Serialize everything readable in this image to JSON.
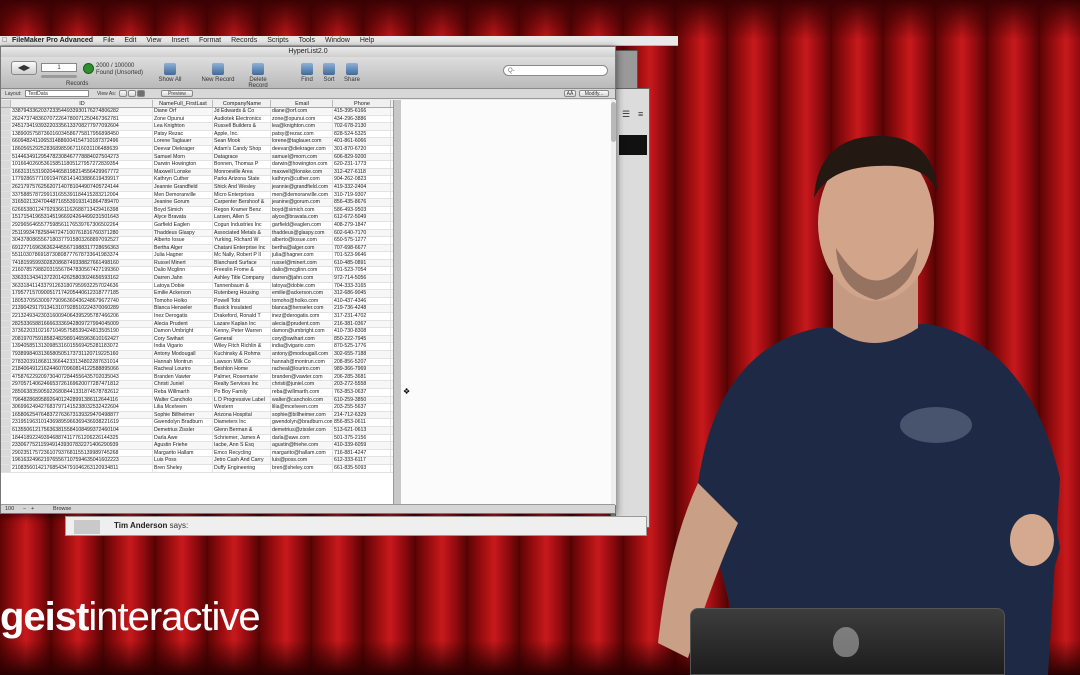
{
  "menubar": {
    "app_name": "FileMaker Pro Advanced",
    "items": [
      "File",
      "Edit",
      "View",
      "Insert",
      "Format",
      "Records",
      "Scripts",
      "Tools",
      "Window",
      "Help"
    ]
  },
  "window": {
    "title": "HyperList2.0",
    "toolbar": {
      "record_input": "1",
      "records_label": "Records",
      "found_count": "2000 / 100000",
      "found_status": "Found (Unsorted)",
      "show_all": "Show All",
      "new_record": "New Record",
      "delete_record": "Delete Record",
      "find": "Find",
      "sort": "Sort",
      "share": "Share",
      "search_placeholder": "Q-"
    },
    "layout_bar": {
      "layout_label": "Layout:",
      "layout_value": "TestData",
      "view_as_label": "View As:",
      "preview_button": "Preview",
      "aa_button": "AÂ",
      "modify_button": "Modify..."
    },
    "table": {
      "columns": [
        "ID",
        "NameFull_FirstLast",
        "CompanyName",
        "Email",
        "Phone"
      ],
      "rows": [
        [
          "3387943362037233544933930176274806282",
          "Diane Orf",
          "Jd Edwards & Co",
          "diane@orf.com",
          "415-395-6166"
        ],
        [
          "2624737483607072264780071250467362781",
          "Zone Opunui",
          "Audiotek Electronics",
          "zone@opunui.com",
          "434-296-3886"
        ],
        [
          "2451734193932203356133708277977092604",
          "Lea Knighton",
          "Russell Builders &",
          "lea@knighton.com",
          "702-678-2130"
        ],
        [
          "1389005758736016034586775817956898450",
          "Patsy Rezac",
          "Apple, Inc.",
          "patsy@rezac.com",
          "828-524-5325"
        ],
        [
          "6609482411065314886004154710187372496",
          "Lorene Taglauer",
          "Sean Mook",
          "lorene@taglauer.com",
          "401-861-6066"
        ],
        [
          "1860565292528368985967116031106488639",
          "Deevar Diekrager",
          "Adam's Candy Shop",
          "deevar@diekrager.com",
          "301-870-6720"
        ],
        [
          "5144634912954782308467778884027504273",
          "Samuel Morn",
          "Datagrace",
          "samuel@morn.com",
          "606-829-9200"
        ],
        [
          "1016640260536158511805127957272839354",
          "Darwin Howington",
          "Bonnen, Thomas P",
          "darwin@howington.com",
          "620-231-1773"
        ],
        [
          "1663131531902044658198214556429967772",
          "Maxwell Lonske",
          "Monroeville Area",
          "maxwell@lonske.com",
          "312-427-6118"
        ],
        [
          "1779286577109194768141403886619439917",
          "Kathryn Cuther",
          "Parks Arizona State",
          "kathryn@cuther.com",
          "904-262-0823"
        ],
        [
          "2621797576256207140781044907405724144",
          "Jeannie Grandfield",
          "Shick And Wesley",
          "jeannie@grandfield.com",
          "419-332-2404"
        ],
        [
          "3375885787299131655391184415283212004",
          "Men Demoranville",
          "Micro Enterprises",
          "men@demoranville.com",
          "310-719-9307"
        ],
        [
          "3165021324704487165539193141864789470",
          "Jeanine Gorum",
          "Carpenter Bershoof &",
          "jeanine@gorum.com",
          "856-435-8676"
        ],
        [
          "6266538012479293661162688713429416398",
          "Boyd Simich",
          "Regon Kramer Benz",
          "boyd@simich.com",
          "586-493-9503"
        ],
        [
          "1517154196531451966924264499231501643",
          "Alyce Bravata",
          "Larsen, Allen S",
          "alyce@bravata.com",
          "612-672-5049"
        ],
        [
          "2929656465577598561176539767306502264",
          "Garfield Eaglen",
          "Cogun Industries Inc",
          "garfield@eaglen.com",
          "408-279-1847"
        ],
        [
          "2511993478258447247100761816760371280",
          "Thaddeus Glaspy",
          "Associated Metals &",
          "thaddeus@glaspy.com",
          "602-640-7170"
        ],
        [
          "3043780865567180377915803268897092527",
          "Alberto Iosue",
          "Yurking, Richard W",
          "alberto@iosue.com",
          "650-575-1277"
        ],
        [
          "6912771696363624455671988317728656363",
          "Bertha Alger",
          "Chatani Enterprise Inc",
          "bertha@alger.com",
          "707-698-6677"
        ],
        [
          "5511030786918730808777678733641983374",
          "Julia Hagner",
          "Mc Nally, Robert P II",
          "julia@hagner.com",
          "701-523-9646"
        ],
        [
          "7418159599302820868749338827661498160",
          "Russel Minert",
          "Blanchard Surface",
          "russel@minert.com",
          "610-485-0891"
        ],
        [
          "2160785798820315567847830567427199360",
          "Dalio Mcglinn",
          "Freeslin Frome &",
          "dalio@mcglinn.com",
          "701-523-7054"
        ],
        [
          "3363313434137220142625803024656593162",
          "Darren Jahn",
          "Ashley Title Company",
          "darren@jahn.com",
          "972-714-5056"
        ],
        [
          "3633184114337912631807959932257024636",
          "Latoya Dobie",
          "Tannenbaum &",
          "latoya@dobie.com",
          "704-333-3165"
        ],
        [
          "1795771570900517174205440612318777185",
          "Emilie Ackerson",
          "Rutenberg Housing",
          "emilie@ackerson.com",
          "312-686-9045"
        ],
        [
          "1805370563009779096360436248679672740",
          "Tomoho Holko",
          "Powell Tobi",
          "tomoho@holko.com",
          "410-437-4346"
        ],
        [
          "2139042917913413107928510224370060289",
          "Blanca Henseler",
          "Busick Insulated",
          "blanca@henseler.com",
          "219-736-4248"
        ],
        [
          "2213249342303160094064395295787466206",
          "Inez Derogatis",
          "Drakeford, Ronald T",
          "inez@derogatis.com",
          "317-231-4702"
        ],
        [
          "2825336588166663336942809727994045009",
          "Alecia Prudent",
          "Lazare Kaplan Inc",
          "alecia@prudent.com",
          "216-381-0367"
        ],
        [
          "3736220310216710495758539424813505190",
          "Damon Umbright",
          "Kenny, Peter Warren",
          "damon@umbright.com",
          "410-730-8308"
        ],
        [
          "2081970759185824829891465963610162427",
          "Cory Swihart",
          "General",
          "cory@swihart.com",
          "850-222-7945"
        ],
        [
          "1394058513130985316015569425281183072",
          "India Vigario",
          "Wiley Fitch Richlin &",
          "india@vigario.com",
          "870-525-1776"
        ],
        [
          "7938998403136580505173731120719225160",
          "Antony Modougall",
          "Kuchinsky & Rohms",
          "antony@modougall.com",
          "302-655-7188"
        ],
        [
          "2783203918681136644233134802287631014",
          "Hannah Montrun",
          "Lawson Milk Co",
          "hannah@montrun.com",
          "208-856-5207"
        ],
        [
          "2184064912162446070960814122588895066",
          "Racheal Louriro",
          "Beshlon Home",
          "racheal@louriro.com",
          "989-366-7969"
        ],
        [
          "4758762292097304072844556435702035043",
          "Branden Vawter",
          "Palmer, Rosemarie",
          "branden@vawter.com",
          "206-285-3681"
        ],
        [
          "2970571406246653726169620077287471812",
          "Christi Juniel",
          "Realty Services Inc",
          "christi@juniel.com",
          "203-272-5558"
        ],
        [
          "2850638359059226808441331874578782612",
          "Reba Willmarth",
          "Po Boy Family",
          "reba@willmarth.com",
          "763-853-0637"
        ],
        [
          "7964828689589264012428991386112644116",
          "Walter Cancholo",
          "L D Progressive Label",
          "walter@cancholo.com",
          "610-259-3850"
        ],
        [
          "3069962494276837971415238032532422604",
          "Lilia Mcelveen",
          "Western",
          "lilia@mcelveen.com",
          "203-255-5637"
        ],
        [
          "1658062547648372763673139329470498877",
          "Sophie Billheimer",
          "Arizona Hospital",
          "sophie@billheimer.com",
          "214-712-6329"
        ],
        [
          "2319519631014369895966369436938221619",
          "Gwendolyn Bradburn",
          "Diameters Inc",
          "gwendolyn@bradburn.com",
          "856-853-0611"
        ],
        [
          "6135506121756363815584108499372460104",
          "Demetrius Zissler",
          "Glenn Berman &",
          "demetrius@zissler.com",
          "513-621-0613"
        ],
        [
          "1844189224939468874117761206226144325",
          "Darla Awe",
          "Schriemer, James A",
          "darla@awe.com",
          "501-375-2156"
        ],
        [
          "2330677521159491439307832271406290939",
          "Agustin Friehe",
          "Iacbe, Ann S Esq",
          "agustin@friehe.com",
          "410-339-6059"
        ],
        [
          "2902351757236107937681155139989745268",
          "Margarito Hallam",
          "Emco Recycling",
          "margarito@hallam.com",
          "716-881-4247"
        ],
        [
          "1961632496219765567107594635041602223",
          "Luis Poss",
          "Jetro Cash And Carry",
          "luis@poss.com",
          "612-333-6117"
        ],
        [
          "2108356014217685434791046263120934811",
          "Bren Sheley",
          "Duffy Engineering",
          "bren@sheley.com",
          "661-835-5093"
        ]
      ]
    },
    "status_bar": {
      "zoom": "100",
      "mode": "Browse"
    }
  },
  "chat": {
    "author": "Tim Anderson",
    "says": "says:"
  },
  "logo": {
    "brand_bold": "geist",
    "brand_light": "interactive"
  }
}
